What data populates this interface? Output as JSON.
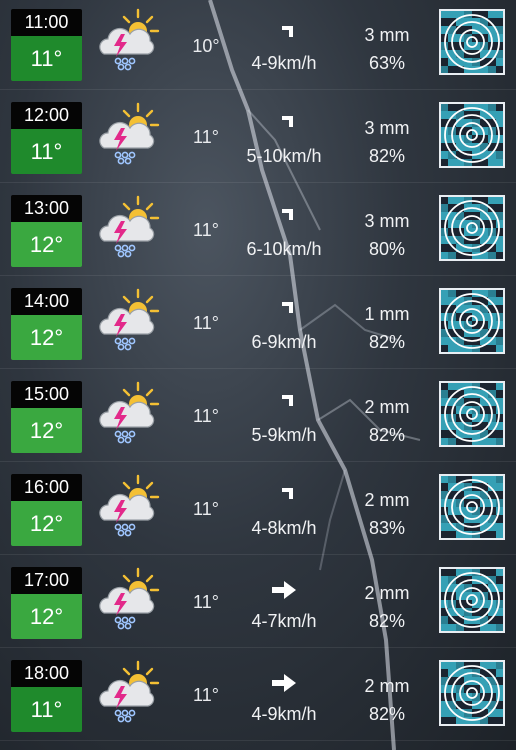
{
  "hours": [
    {
      "time": "11:00",
      "temp": "11°",
      "temp_color": "#1f8a2c",
      "feels": "10°",
      "wind_dir": "ne",
      "wind": "4-9km/h",
      "rain": "3 mm",
      "prob": "63%"
    },
    {
      "time": "12:00",
      "temp": "11°",
      "temp_color": "#1f8a2c",
      "feels": "11°",
      "wind_dir": "ne",
      "wind": "5-10km/h",
      "rain": "3 mm",
      "prob": "82%"
    },
    {
      "time": "13:00",
      "temp": "12°",
      "temp_color": "#3aa840",
      "feels": "11°",
      "wind_dir": "ne",
      "wind": "6-10km/h",
      "rain": "3 mm",
      "prob": "80%"
    },
    {
      "time": "14:00",
      "temp": "12°",
      "temp_color": "#3aa840",
      "feels": "11°",
      "wind_dir": "ne",
      "wind": "6-9km/h",
      "rain": "1 mm",
      "prob": "82%"
    },
    {
      "time": "15:00",
      "temp": "12°",
      "temp_color": "#3aa840",
      "feels": "11°",
      "wind_dir": "ne",
      "wind": "5-9km/h",
      "rain": "2 mm",
      "prob": "82%"
    },
    {
      "time": "16:00",
      "temp": "12°",
      "temp_color": "#3aa840",
      "feels": "11°",
      "wind_dir": "ne",
      "wind": "4-8km/h",
      "rain": "2 mm",
      "prob": "83%"
    },
    {
      "time": "17:00",
      "temp": "12°",
      "temp_color": "#3aa840",
      "feels": "11°",
      "wind_dir": "e",
      "wind": "4-7km/h",
      "rain": "2 mm",
      "prob": "82%"
    },
    {
      "time": "18:00",
      "temp": "11°",
      "temp_color": "#1f8a2c",
      "feels": "11°",
      "wind_dir": "e",
      "wind": "4-9km/h",
      "rain": "2 mm",
      "prob": "82%"
    }
  ],
  "icons": {
    "weather": "thunderstorm-sun-icon",
    "wind": "wind-arrow-icon",
    "radar": "radar-icon"
  },
  "colors": {
    "lightning_bolt": "#e2298a",
    "sun": "#f4c034",
    "radar_cyan": "#35a0b5"
  }
}
